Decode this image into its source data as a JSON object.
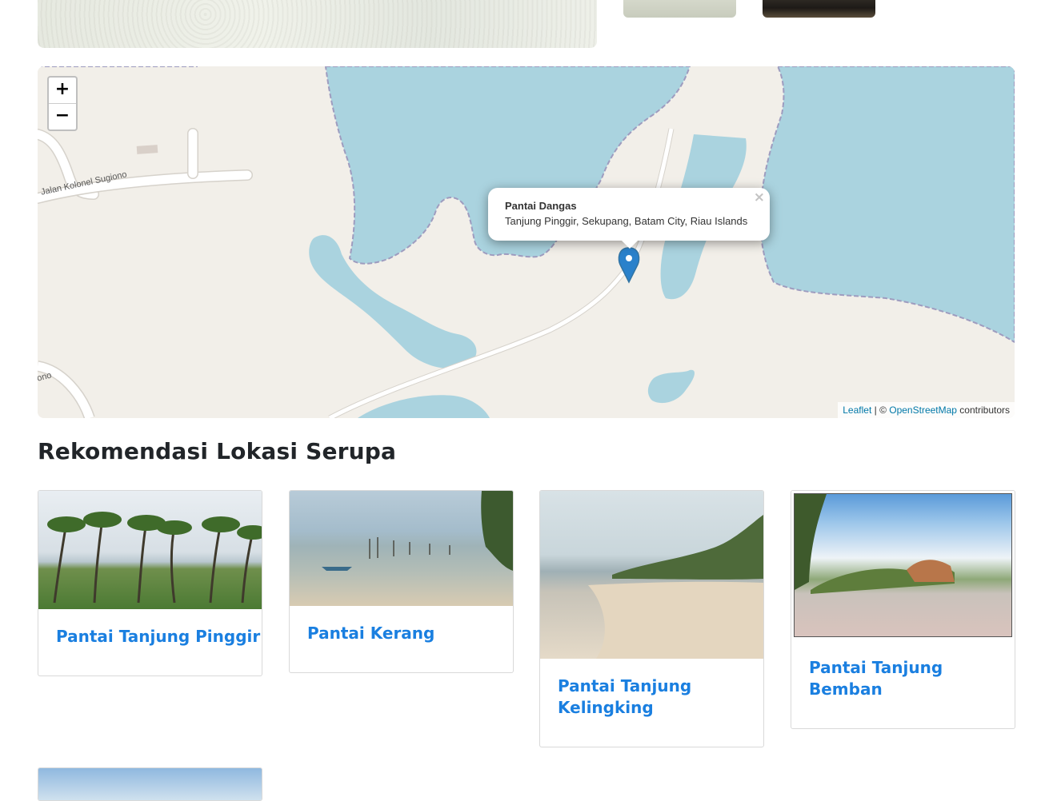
{
  "gallery": {
    "main_image": "beach-sand-photo",
    "thumbnails": [
      "sand-photo",
      "dark-photo"
    ]
  },
  "map": {
    "zoom_in_label": "+",
    "zoom_out_label": "−",
    "popup": {
      "title": "Pantai Dangas",
      "address": "Tanjung Pinggir, Sekupang, Batam City, Riau Islands",
      "close_label": "×"
    },
    "road_labels": [
      "Jalan Kolonel Sugiono",
      "ono"
    ],
    "attribution": {
      "leaflet": "Leaflet",
      "separator": " | © ",
      "osm": "OpenStreetMap",
      "suffix": " contributors"
    },
    "colors": {
      "water": "#aad3df",
      "land": "#f2efe9",
      "road": "#ffffff",
      "boundary": "#9e9cbf",
      "marker": "#2a81cb"
    }
  },
  "recommendations": {
    "title": "Rekomendasi Lokasi Serupa",
    "items": [
      {
        "name": "Pantai Tanjung Pinggir",
        "image": "palm-beach-photo"
      },
      {
        "name": "Pantai Kerang",
        "image": "boat-sea-photo"
      },
      {
        "name": "Pantai Tanjung Kelingking",
        "image": "sandy-shore-photo"
      },
      {
        "name": "Pantai Tanjung Bemban",
        "image": "cliff-coast-photo"
      }
    ]
  },
  "colors": {
    "link": "#1a7fe0",
    "heading": "#212529"
  }
}
